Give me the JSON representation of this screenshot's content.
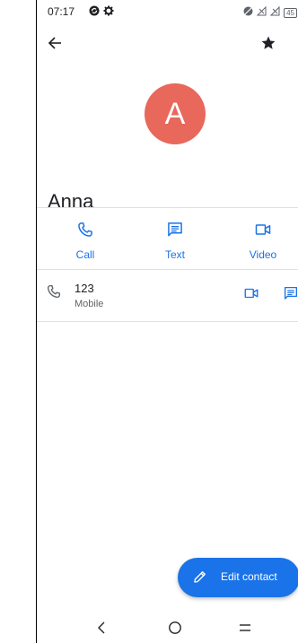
{
  "status_bar": {
    "time": "07:17",
    "battery_level": "45",
    "left_icons": [
      "sync-icon",
      "settings-icon"
    ],
    "right_icons": [
      "vibrate-icon",
      "no-signal-icon",
      "no-signal-icon-2",
      "battery-icon"
    ]
  },
  "top_bar": {
    "back_icon": "arrow-back-icon",
    "favorite_icon": "star-icon"
  },
  "contact": {
    "avatar_letter": "A",
    "avatar_color": "#e8685c",
    "name": "Anna"
  },
  "actions": [
    {
      "label": "Call",
      "icon": "phone-icon"
    },
    {
      "label": "Text",
      "icon": "message-icon"
    },
    {
      "label": "Video",
      "icon": "video-icon"
    }
  ],
  "phone_entry": {
    "number": "123",
    "type": "Mobile",
    "icons": [
      "phone-icon",
      "video-icon",
      "message-icon"
    ]
  },
  "fab": {
    "label": "Edit contact",
    "icon": "pencil-icon"
  },
  "nav_bar": {
    "icons": [
      "back-icon",
      "home-icon",
      "menu-icon"
    ]
  },
  "colors": {
    "accent": "#1a73e8",
    "avatar": "#e8685c",
    "text_primary": "#202124",
    "text_secondary": "#5f6368"
  }
}
